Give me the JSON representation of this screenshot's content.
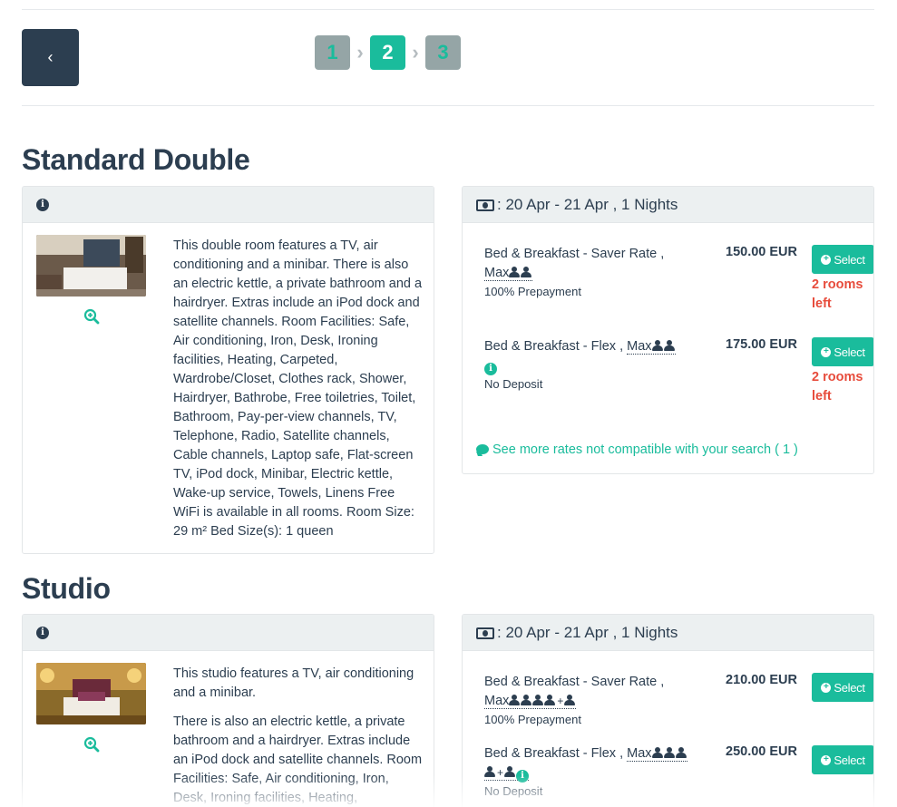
{
  "nav": {
    "back_label": "‹",
    "steps": [
      "1",
      "2",
      "3"
    ],
    "active_step": "2",
    "step_separator": "›"
  },
  "colors": {
    "primary_dark": "#2c3e50",
    "accent": "#1abc9c",
    "danger": "#e74c3c",
    "panel_header": "#ecf0f1"
  },
  "rooms": [
    {
      "title": "Standard Double",
      "info_icon": "info-circle-icon",
      "zoom_icon": "zoom-in-icon",
      "description": [
        "This double room features a TV, air conditioning and a minibar. There is also an electric kettle, a private bathroom and a hairdryer. Extras include an iPod dock and satellite channels. Room Facilities: Safe, Air conditioning, Iron, Desk, Ironing facilities, Heating, Carpeted, Wardrobe/Closet, Clothes rack, Shower, Hairdryer, Bathrobe, Free toiletries, Toilet, Bathroom, Pay-per-view channels, TV, Telephone, Radio, Satellite channels, Cable channels, Laptop safe, Flat-screen TV, iPod dock, Minibar, Electric kettle, Wake-up service, Towels, Linens Free WiFi is available in all rooms. Room Size: 29 m² Bed Size(s): 1 queen"
      ],
      "dates": ": 20 Apr - 21 Apr , 1 Nights",
      "rates": [
        {
          "name": "Bed & Breakfast - Saver Rate ,",
          "max_label": "Max",
          "occupancy_icons": "2 person-icon",
          "condition": "100% Prepayment",
          "price": "150.00 EUR",
          "select_label": "Select",
          "availability": "2 rooms left"
        },
        {
          "name": "Bed & Breakfast - Flex ,",
          "max_label": "Max",
          "occupancy_icons": "2 person-icon + info-icon",
          "condition": "No Deposit",
          "price": "175.00 EUR",
          "select_label": "Select",
          "availability": "2 rooms left"
        }
      ],
      "see_more": "See more rates not compatible with your search ( 1 )"
    },
    {
      "title": "Studio",
      "info_icon": "info-circle-icon",
      "zoom_icon": "zoom-in-icon",
      "description": [
        "This studio features a TV, air conditioning and a minibar.",
        "There is also an electric kettle, a private bathroom and a hairdryer. Extras include an iPod dock and satellite channels. Room Facilities: Safe, Air conditioning, Iron, Desk, Ironing facilities, Heating,"
      ],
      "dates": ": 20 Apr - 21 Apr , 1 Nights",
      "rates": [
        {
          "name": "Bed & Breakfast - Saver Rate ,",
          "max_label": "Max",
          "occupancy_icons": "4 person-icon + 1 person-icon",
          "condition": "100% Prepayment",
          "price": "210.00 EUR",
          "select_label": "Select",
          "availability": ""
        },
        {
          "name": "Bed & Breakfast - Flex ,",
          "max_label": "Max",
          "occupancy_icons": "4 person-icon + 1 person-icon + info-icon",
          "condition": "No Deposit",
          "price": "250.00 EUR",
          "select_label": "Select",
          "availability": ""
        }
      ]
    }
  ]
}
